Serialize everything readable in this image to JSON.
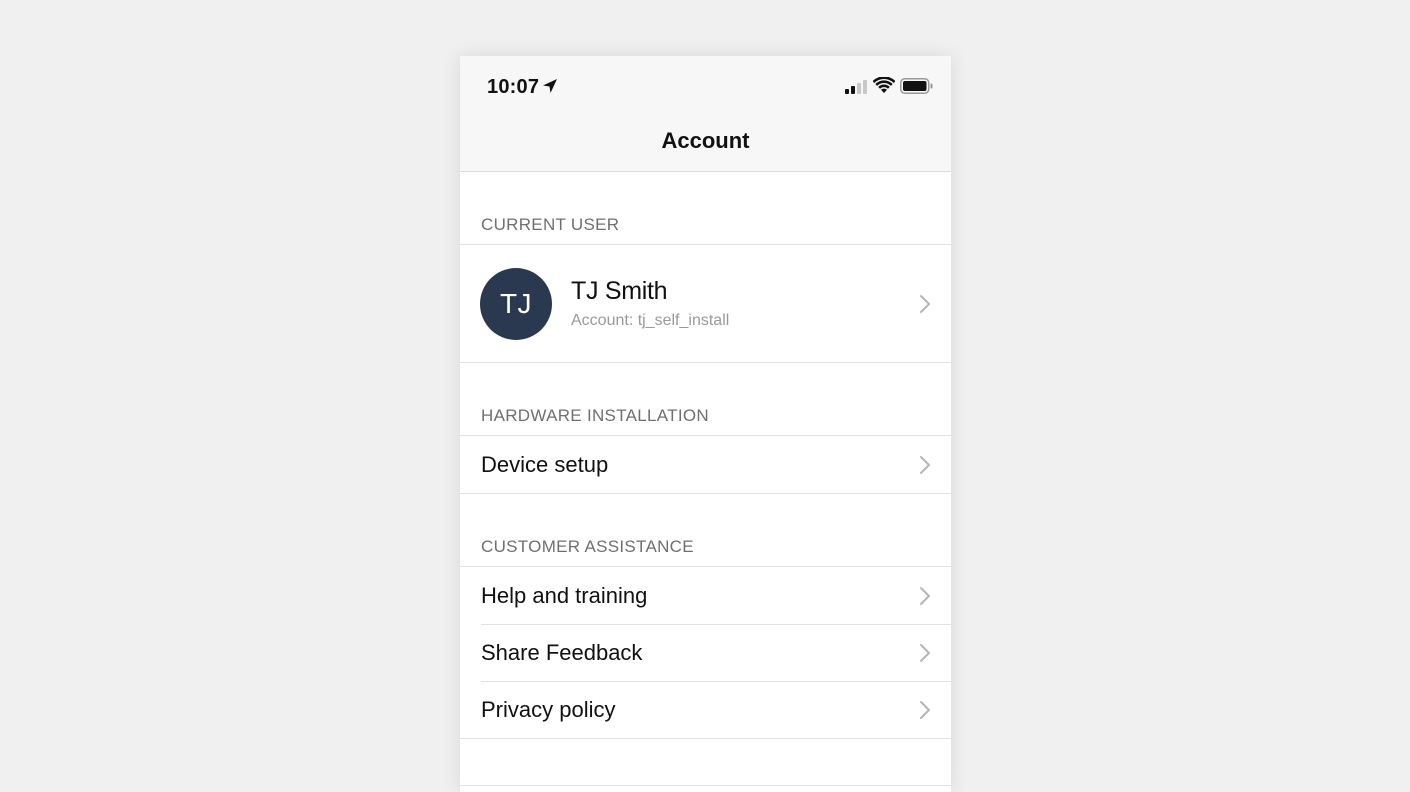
{
  "status_bar": {
    "time": "10:07",
    "icons": [
      "location-arrow-icon",
      "cellular-signal-icon",
      "wifi-icon",
      "battery-icon"
    ]
  },
  "nav": {
    "title": "Account"
  },
  "sections": {
    "current_user": {
      "header": "CURRENT USER",
      "user": {
        "initials": "TJ",
        "name": "TJ Smith",
        "account": "Account: tj_self_install"
      }
    },
    "hardware_installation": {
      "header": "HARDWARE INSTALLATION",
      "items": [
        {
          "label": "Device setup"
        }
      ]
    },
    "customer_assistance": {
      "header": "CUSTOMER ASSISTANCE",
      "items": [
        {
          "label": "Help and training"
        },
        {
          "label": "Share Feedback"
        },
        {
          "label": "Privacy policy"
        }
      ]
    }
  },
  "colors": {
    "avatar_bg": "#2b3950",
    "page_bg": "#f0f0f0",
    "nav_bg": "#f7f7f7",
    "section_header_text": "#6f6f6f",
    "chevron": "#b5b5b5"
  }
}
